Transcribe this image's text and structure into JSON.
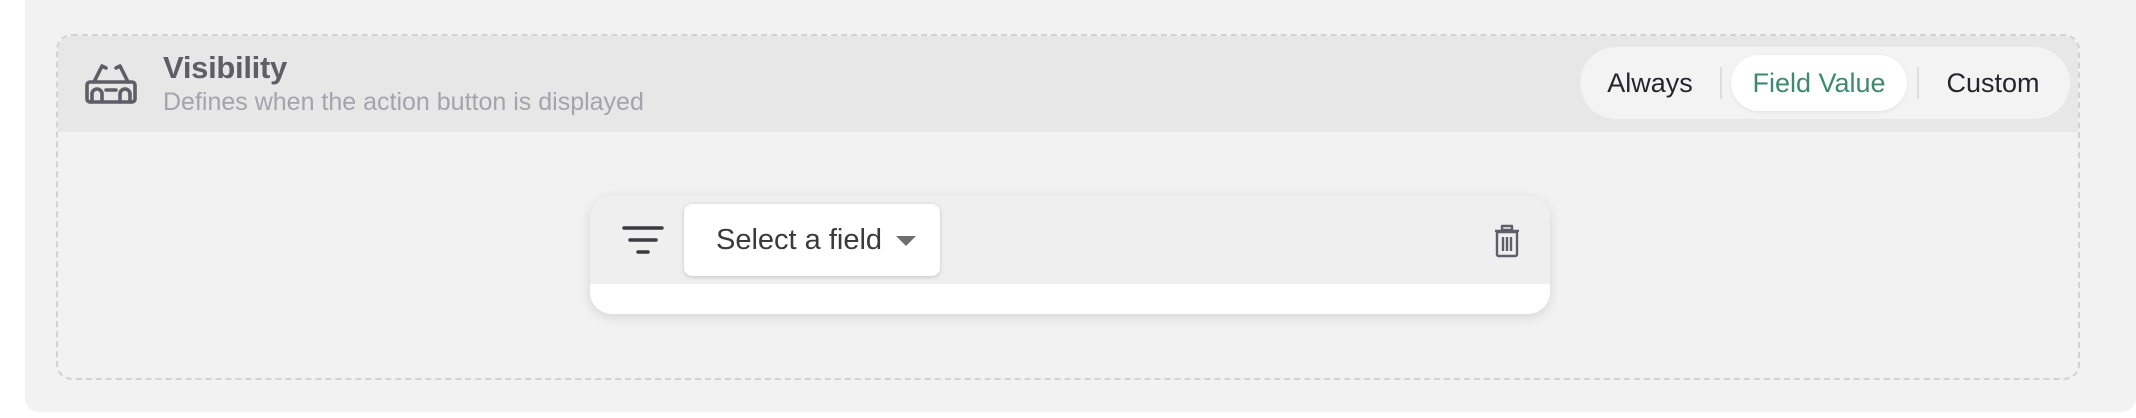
{
  "visibility": {
    "title": "Visibility",
    "subtitle": "Defines when the action button is displayed",
    "icon": "glasses-icon",
    "modes": {
      "always": "Always",
      "field_value": "Field Value",
      "custom": "Custom",
      "selected": "Field Value"
    }
  },
  "condition": {
    "filter_icon": "filter-icon",
    "field_select": {
      "value": "Select a field"
    },
    "delete_icon": "trash-icon"
  },
  "colors": {
    "accent": "#3d8a6e",
    "header_bg": "#e7e7e8",
    "panel_bg": "#f2f2f2"
  }
}
